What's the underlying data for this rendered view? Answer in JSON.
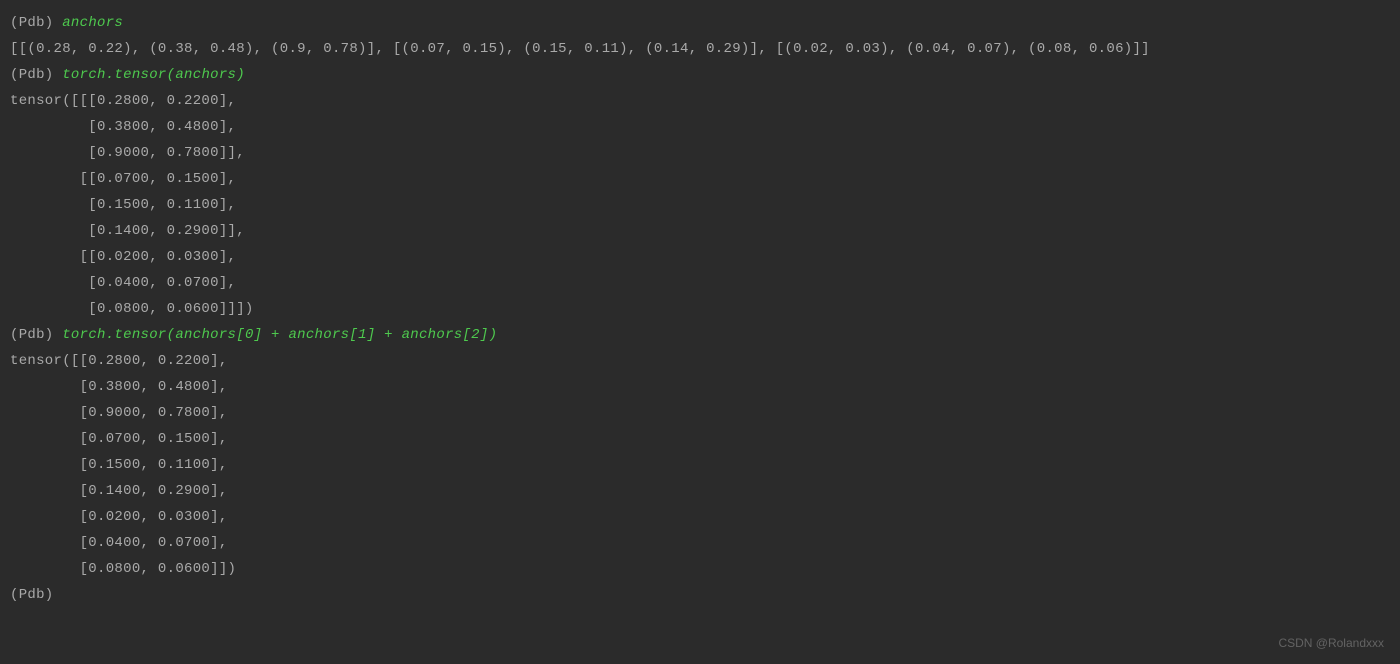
{
  "prompt": "(Pdb) ",
  "entries": [
    {
      "cmd": "anchors",
      "out": [
        "[[(0.28, 0.22), (0.38, 0.48), (0.9, 0.78)], [(0.07, 0.15), (0.15, 0.11), (0.14, 0.29)], [(0.02, 0.03), (0.04, 0.07), (0.08, 0.06)]]"
      ]
    },
    {
      "cmd": "torch.tensor(anchors)",
      "out": [
        "tensor([[[0.2800, 0.2200],",
        "         [0.3800, 0.4800],",
        "         [0.9000, 0.7800]],",
        "",
        "        [[0.0700, 0.1500],",
        "         [0.1500, 0.1100],",
        "         [0.1400, 0.2900]],",
        "",
        "        [[0.0200, 0.0300],",
        "         [0.0400, 0.0700],",
        "         [0.0800, 0.0600]]])"
      ]
    },
    {
      "cmd": "torch.tensor(anchors[0] + anchors[1] + anchors[2])",
      "out": [
        "tensor([[0.2800, 0.2200],",
        "        [0.3800, 0.4800],",
        "        [0.9000, 0.7800],",
        "        [0.0700, 0.1500],",
        "        [0.1500, 0.1100],",
        "        [0.1400, 0.2900],",
        "        [0.0200, 0.0300],",
        "        [0.0400, 0.0700],",
        "        [0.0800, 0.0600]])"
      ]
    },
    {
      "cmd": "",
      "out": []
    }
  ],
  "watermark": "CSDN @Rolandxxx"
}
